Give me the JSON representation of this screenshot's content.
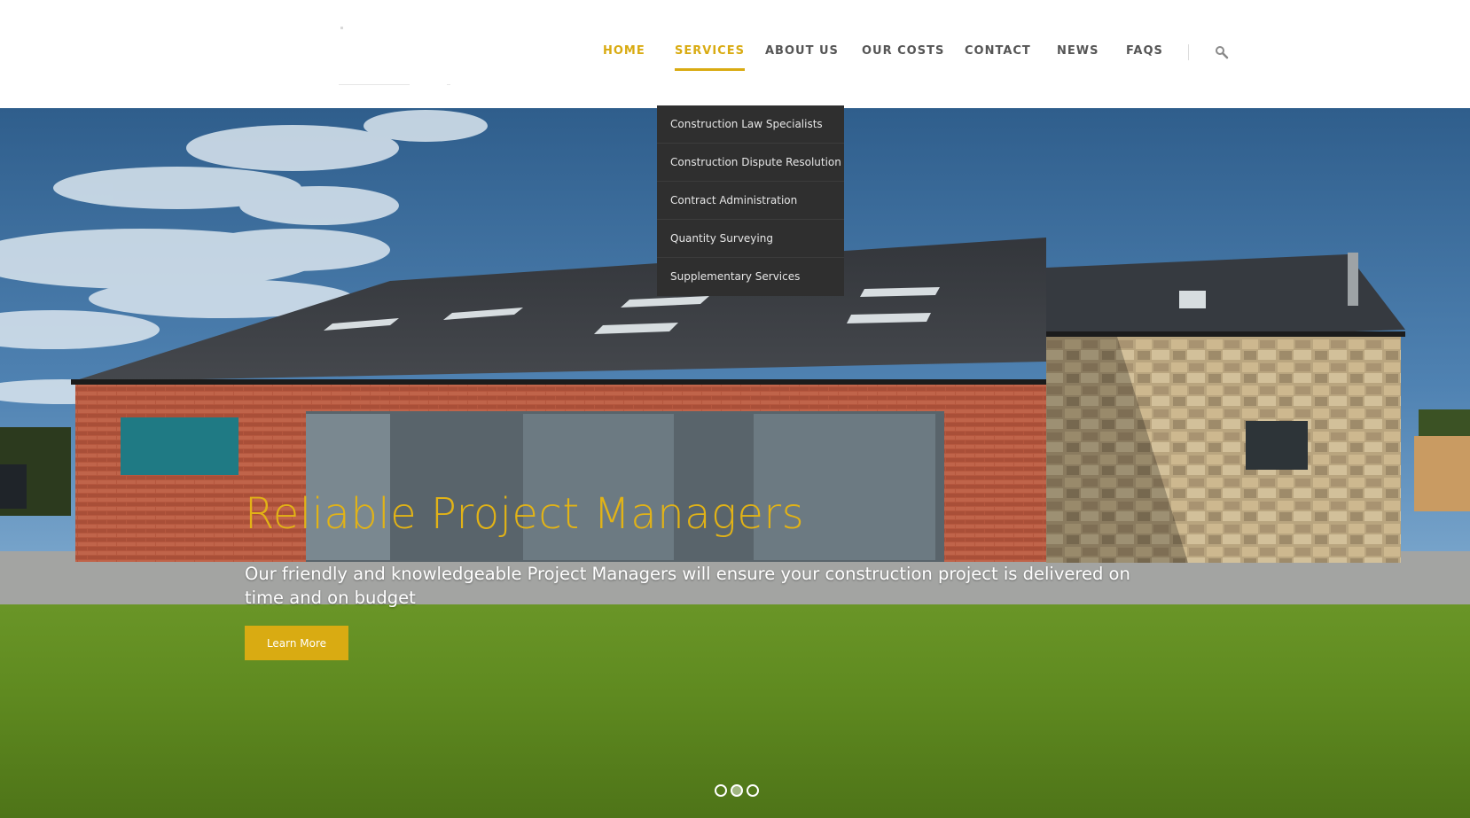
{
  "nav": {
    "items": [
      {
        "label": "HOME",
        "active": true
      },
      {
        "label": "SERVICES",
        "active": true,
        "current": true
      },
      {
        "label": "ABOUT US"
      },
      {
        "label": "OUR COSTS"
      },
      {
        "label": "CONTACT"
      },
      {
        "label": "NEWS"
      },
      {
        "label": "FAQS"
      }
    ],
    "search_icon": "search-icon"
  },
  "services_menu": {
    "items": [
      "Construction Law Specialists",
      "Construction Dispute Resolution",
      "Contract Administration",
      "Quantity Surveying",
      "Supplementary Services"
    ]
  },
  "hero": {
    "title": "Reliable Project Managers",
    "subtitle": "Our friendly and knowledgeable Project Managers will ensure your construction project is delivered on time and on budget",
    "button_label": "Learn More",
    "slides": 3,
    "active_slide": 2
  },
  "colors": {
    "accent": "#d9ab12",
    "dropdown_bg": "#2f2f2f",
    "nav_text": "#555555"
  }
}
